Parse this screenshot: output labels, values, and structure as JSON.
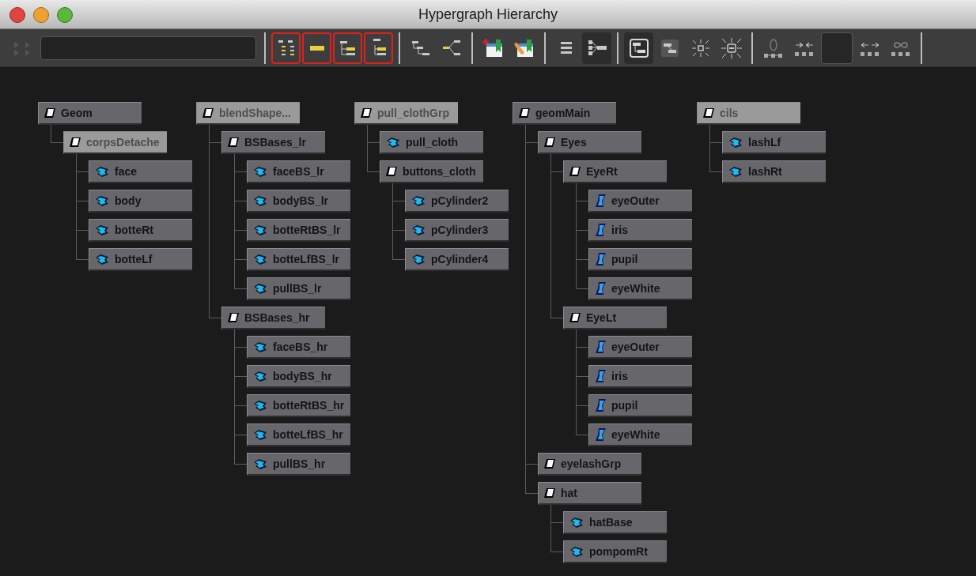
{
  "window": {
    "title": "Hypergraph Hierarchy"
  },
  "toolbar": {
    "buttons": [
      {
        "kind": "frame",
        "selected": false,
        "outlined": false
      },
      {
        "kind": "field"
      },
      {
        "kind": "sep"
      },
      {
        "kind": "tree-all",
        "selected": false,
        "outlined": true
      },
      {
        "kind": "bar",
        "selected": false,
        "outlined": true
      },
      {
        "kind": "tree-child",
        "selected": false,
        "outlined": true
      },
      {
        "kind": "tree-parent",
        "selected": false,
        "outlined": true
      },
      {
        "kind": "sep"
      },
      {
        "kind": "steps",
        "selected": false,
        "outlined": false
      },
      {
        "kind": "branch",
        "selected": false,
        "outlined": false
      },
      {
        "kind": "sep"
      },
      {
        "kind": "bookmark-add",
        "selected": false,
        "outlined": false
      },
      {
        "kind": "bookmark-edit",
        "selected": false,
        "outlined": false
      },
      {
        "kind": "sep"
      },
      {
        "kind": "list",
        "selected": false,
        "outlined": false
      },
      {
        "kind": "hierarchy",
        "selected": true,
        "outlined": false
      },
      {
        "kind": "sep"
      },
      {
        "kind": "layout",
        "selected": true,
        "outlined": false
      },
      {
        "kind": "layout2",
        "selected": false,
        "outlined": false
      },
      {
        "kind": "shrink",
        "selected": false,
        "outlined": false
      },
      {
        "kind": "expand",
        "selected": false,
        "outlined": false
      },
      {
        "kind": "sep"
      },
      {
        "kind": "zero",
        "selected": false,
        "outlined": false
      },
      {
        "kind": "merge",
        "selected": false,
        "outlined": false
      },
      {
        "kind": "swatch"
      },
      {
        "kind": "split",
        "selected": false,
        "outlined": false
      },
      {
        "kind": "infinity",
        "selected": false,
        "outlined": false
      },
      {
        "kind": "sep"
      }
    ]
  },
  "graph": {
    "trees": [
      {
        "name": "Geom",
        "kind": "transform",
        "dimmed": false,
        "children": [
          {
            "name": "corpsDetache",
            "kind": "transform",
            "dimmed": true,
            "children": [
              {
                "name": "face",
                "kind": "mesh",
                "dimmed": false
              },
              {
                "name": "body",
                "kind": "mesh",
                "dimmed": false
              },
              {
                "name": "botteRt",
                "kind": "mesh",
                "dimmed": false
              },
              {
                "name": "botteLf",
                "kind": "mesh",
                "dimmed": false
              }
            ]
          }
        ]
      },
      {
        "name": "blendShape...",
        "kind": "transform",
        "dimmed": true,
        "children": [
          {
            "name": "BSBases_lr",
            "kind": "transform",
            "dimmed": false,
            "children": [
              {
                "name": "faceBS_lr",
                "kind": "mesh",
                "dimmed": false
              },
              {
                "name": "bodyBS_lr",
                "kind": "mesh",
                "dimmed": false
              },
              {
                "name": "botteRtBS_lr",
                "kind": "mesh",
                "dimmed": false
              },
              {
                "name": "botteLfBS_lr",
                "kind": "mesh",
                "dimmed": false
              },
              {
                "name": "pullBS_lr",
                "kind": "mesh",
                "dimmed": false
              }
            ]
          },
          {
            "name": "BSBases_hr",
            "kind": "transform",
            "dimmed": false,
            "children": [
              {
                "name": "faceBS_hr",
                "kind": "mesh",
                "dimmed": false
              },
              {
                "name": "bodyBS_hr",
                "kind": "mesh",
                "dimmed": false
              },
              {
                "name": "botteRtBS_hr",
                "kind": "mesh",
                "dimmed": false
              },
              {
                "name": "botteLfBS_hr",
                "kind": "mesh",
                "dimmed": false
              },
              {
                "name": "pullBS_hr",
                "kind": "mesh",
                "dimmed": false
              }
            ]
          }
        ]
      },
      {
        "name": "pull_clothGrp",
        "kind": "transform",
        "dimmed": true,
        "children": [
          {
            "name": "pull_cloth",
            "kind": "mesh",
            "dimmed": false
          },
          {
            "name": "buttons_cloth",
            "kind": "transform",
            "dimmed": false,
            "children": [
              {
                "name": "pCylinder2",
                "kind": "mesh",
                "dimmed": false
              },
              {
                "name": "pCylinder3",
                "kind": "mesh",
                "dimmed": false
              },
              {
                "name": "pCylinder4",
                "kind": "mesh",
                "dimmed": false
              }
            ]
          }
        ]
      },
      {
        "name": "geomMain",
        "kind": "transform",
        "dimmed": false,
        "children": [
          {
            "name": "Eyes",
            "kind": "transform",
            "dimmed": false,
            "children": [
              {
                "name": "EyeRt",
                "kind": "transform",
                "dimmed": false,
                "children": [
                  {
                    "name": "eyeOuter",
                    "kind": "nurbs",
                    "dimmed": false
                  },
                  {
                    "name": "iris",
                    "kind": "nurbs",
                    "dimmed": false
                  },
                  {
                    "name": "pupil",
                    "kind": "nurbs",
                    "dimmed": false
                  },
                  {
                    "name": "eyeWhite",
                    "kind": "nurbs",
                    "dimmed": false
                  }
                ]
              },
              {
                "name": "EyeLt",
                "kind": "transform",
                "dimmed": false,
                "children": [
                  {
                    "name": "eyeOuter",
                    "kind": "nurbs",
                    "dimmed": false
                  },
                  {
                    "name": "iris",
                    "kind": "nurbs",
                    "dimmed": false
                  },
                  {
                    "name": "pupil",
                    "kind": "nurbs",
                    "dimmed": false
                  },
                  {
                    "name": "eyeWhite",
                    "kind": "nurbs",
                    "dimmed": false
                  }
                ]
              }
            ]
          },
          {
            "name": "eyelashGrp",
            "kind": "transform",
            "dimmed": false
          },
          {
            "name": "hat",
            "kind": "transform",
            "dimmed": false,
            "children": [
              {
                "name": "hatBase",
                "kind": "mesh",
                "dimmed": false
              },
              {
                "name": "pompomRt",
                "kind": "mesh",
                "dimmed": false
              }
            ]
          }
        ]
      },
      {
        "name": "cils",
        "kind": "transform",
        "dimmed": true,
        "children": [
          {
            "name": "lashLf",
            "kind": "mesh",
            "dimmed": false
          },
          {
            "name": "lashRt",
            "kind": "mesh",
            "dimmed": false
          }
        ]
      }
    ]
  }
}
